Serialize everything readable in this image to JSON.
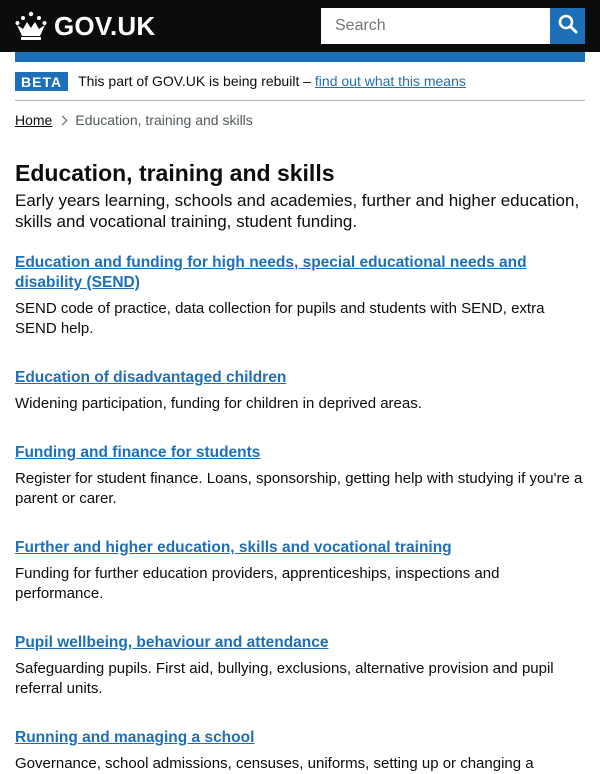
{
  "header": {
    "logo_text": "GOV.UK",
    "search_placeholder": "Search",
    "accent_color": "#1d70b8"
  },
  "phase_banner": {
    "tag": "BETA",
    "text": "This part of GOV.UK is being rebuilt – ",
    "link": "find out what this means"
  },
  "breadcrumb": {
    "home": "Home",
    "current": "Education, training and skills"
  },
  "page": {
    "title": "Education, training and skills",
    "description": "Early years learning, schools and academies, further and higher education, skills and vocational training, student funding."
  },
  "topics": [
    {
      "title": "Education and funding for high needs, special educational needs and disability (SEND)",
      "description": "SEND code of practice, data collection for pupils and students with SEND, extra SEND help."
    },
    {
      "title": "Education of disadvantaged children",
      "description": "Widening participation, funding for children in deprived areas."
    },
    {
      "title": "Funding and finance for students",
      "description": "Register for student finance. Loans, sponsorship, getting help with studying if you're a parent or carer."
    },
    {
      "title": "Further and higher education, skills and vocational training",
      "description": "Funding for further education providers, apprenticeships, inspections and performance."
    },
    {
      "title": "Pupil wellbeing, behaviour and attendance",
      "description": "Safeguarding pupils. First aid, bullying, exclusions, alternative provision and pupil referral units."
    },
    {
      "title": "Running and managing a school",
      "description": "Governance, school admissions, censuses, uniforms, setting up or changing a"
    }
  ]
}
